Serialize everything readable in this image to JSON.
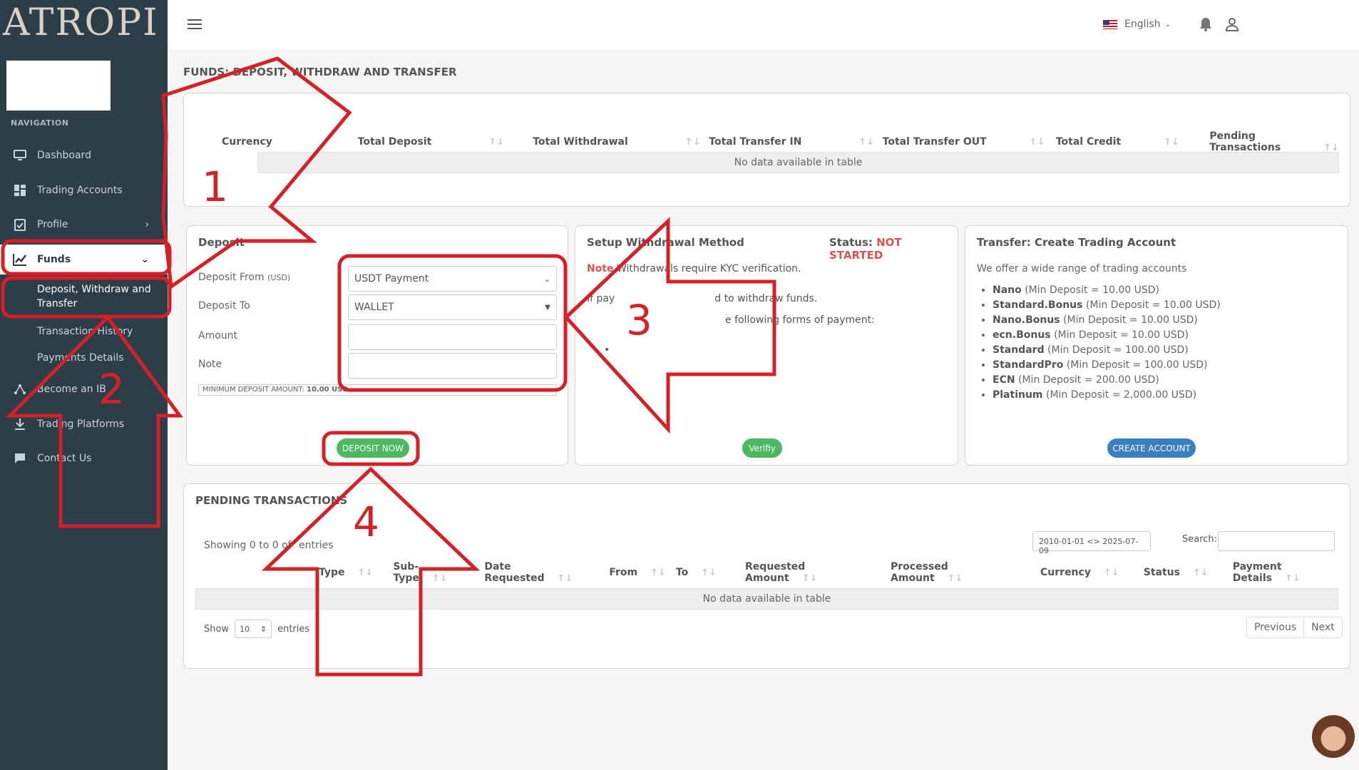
{
  "brand": {
    "logo_text": "ATROPI"
  },
  "sidebar": {
    "heading": "NAVIGATION",
    "items": [
      {
        "label": "Dashboard",
        "icon": "monitor-icon"
      },
      {
        "label": "Trading Accounts",
        "icon": "grid-icon"
      },
      {
        "label": "Profile",
        "icon": "clipboard-icon"
      },
      {
        "label": "Funds",
        "icon": "chart-icon"
      },
      {
        "label": "Become an IB",
        "icon": "network-icon"
      },
      {
        "label": "Trading Platforms",
        "icon": "download-icon"
      },
      {
        "label": "Contact Us",
        "icon": "chat-icon"
      }
    ],
    "sub_items": [
      "Deposit, Withdraw and Transfer",
      "Transaction History",
      "Payments Details"
    ]
  },
  "topbar": {
    "language": "English"
  },
  "page_title": "FUNDS: DEPOSIT, WITHDRAW AND TRANSFER",
  "summary_table": {
    "columns": [
      "Currency",
      "Total Deposit",
      "Total Withdrawal",
      "Total Transfer IN",
      "Total Transfer OUT",
      "Total Credit",
      "Pending Transactions"
    ],
    "empty_text": "No data available in table"
  },
  "deposit": {
    "title": "Deposit",
    "from_label": "Deposit From",
    "from_unit": "(USD)",
    "from_value": "USDT Payment",
    "to_label": "Deposit To",
    "to_value": "WALLET",
    "amount_label": "Amount",
    "note_label": "Note",
    "min_label": "MINIMUM DEPOSIT AMOUNT:",
    "min_value": "10.00 USD",
    "button": "DEPOSIT NOW"
  },
  "withdrawal": {
    "title": "Setup Withdrawal Method",
    "status_label": "Status:",
    "status_value": "NOT STARTED",
    "note_label": "Note",
    "note_text": "Withdrawals require KYC verification.",
    "line1_a": "If pay",
    "line1_b": "d to withdraw funds.",
    "line2": "e following forms of payment:",
    "button": "Verifiy"
  },
  "transfer": {
    "title": "Transfer: Create Trading Account",
    "intro": "We offer a wide range of trading accounts",
    "accounts": [
      {
        "name": "Nano",
        "detail": "(Min Deposit = 10.00 USD)"
      },
      {
        "name": "Standard.Bonus",
        "detail": "(Min Deposit = 10.00 USD)"
      },
      {
        "name": "Nano.Bonus",
        "detail": "(Min Deposit = 10.00 USD)"
      },
      {
        "name": "ecn.Bonus",
        "detail": "(Min Deposit = 10.00 USD)"
      },
      {
        "name": "Standard",
        "detail": "(Min Deposit = 100.00 USD)"
      },
      {
        "name": "StandardPro",
        "detail": "(Min Deposit = 100.00 USD)"
      },
      {
        "name": "ECN",
        "detail": "(Min Deposit = 200.00 USD)"
      },
      {
        "name": "Platinum",
        "detail": "(Min Deposit = 2,000.00 USD)"
      }
    ],
    "button": "CREATE ACCOUNT"
  },
  "pending": {
    "title": "PENDING TRANSACTIONS",
    "showing_a": "Showing 0 to 0 of",
    "showing_b": "entries",
    "date_range": "2010-01-01 <> 2025-07-09",
    "search_label": "Search:",
    "columns": [
      "Type",
      "Sub-Type",
      "Date Requested",
      "From",
      "To",
      "Requested Amount",
      "Processed Amount",
      "Currency",
      "Status",
      "Payment Details"
    ],
    "empty_text": "No data available in table",
    "show_label": "Show",
    "show_value": "10",
    "entries_label": "entries",
    "prev": "Previous",
    "next": "Next"
  },
  "annotations": [
    "1",
    "2",
    "3",
    "4"
  ],
  "colors": {
    "sidebar": "#2c3e4a",
    "annotation": "#d62027",
    "green": "#4cb860",
    "blue": "#3a7fc1",
    "status_red": "#d9534f"
  }
}
